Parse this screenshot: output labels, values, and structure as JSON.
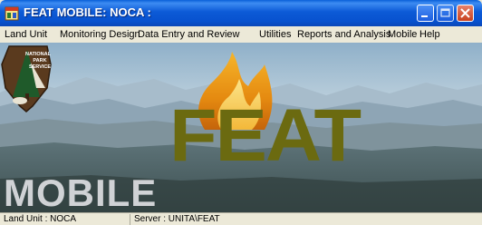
{
  "window": {
    "title": "FEAT MOBILE: NOCA :"
  },
  "menu": {
    "items": [
      "Land Unit",
      "Monitoring Design",
      "Data Entry and Review",
      "Utilities",
      "Reports and Analysis",
      "Mobile",
      "Help"
    ]
  },
  "splash": {
    "logo_text": "FEAT",
    "mobile_text": "MOBILE",
    "nps_top": "NATIONAL",
    "nps_mid": "PARK",
    "nps_bottom": "SERVICE"
  },
  "status": {
    "land_unit": "Land Unit : NOCA",
    "server": "Server : UNITA\\FEAT"
  },
  "icons": {
    "app": "app-window-icon",
    "minimize": "minimize-icon",
    "maximize": "maximize-icon",
    "close": "close-icon",
    "flame": "flame-icon",
    "nps": "arrowhead-emblem-icon"
  }
}
